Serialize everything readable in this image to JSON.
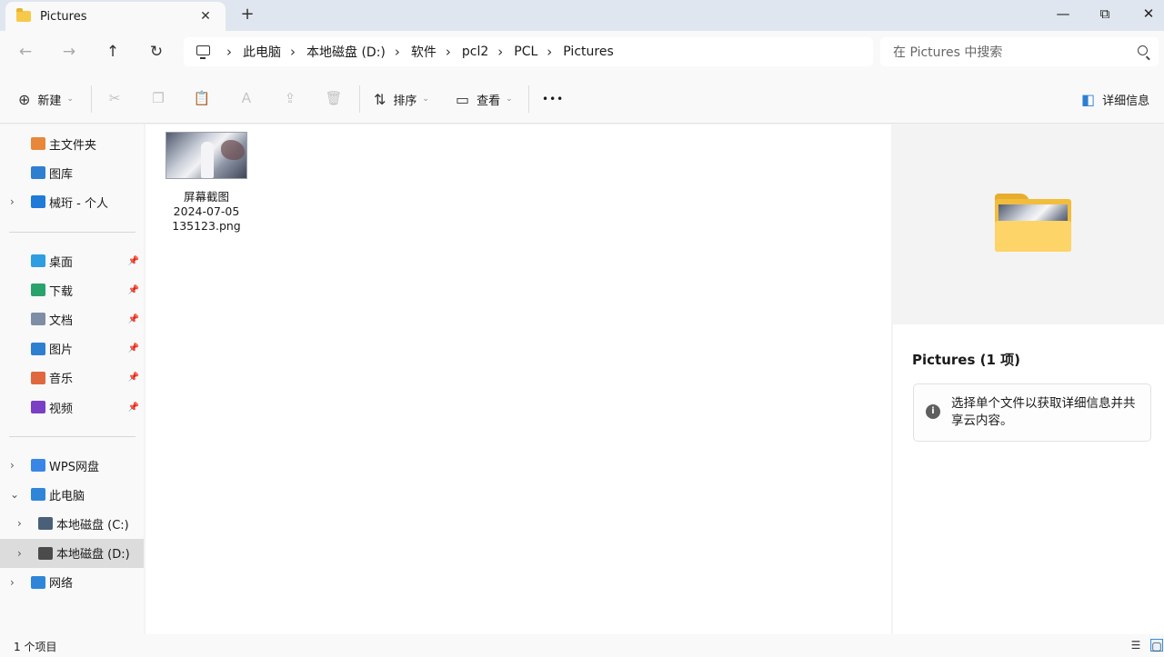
{
  "window": {
    "tab_title": "Pictures",
    "tab_close": "✕",
    "new_tab": "+",
    "minimize": "—",
    "restore": "⧉",
    "close": "✕"
  },
  "nav": {
    "back": "←",
    "forward": "→",
    "up": "↑",
    "refresh": "↻",
    "separator": "›",
    "breadcrumbs": [
      "此电脑",
      "本地磁盘 (D:)",
      "软件",
      "pcl2",
      "PCL",
      "Pictures"
    ],
    "search_placeholder": "在 Pictures 中搜索"
  },
  "toolbar": {
    "new_label": "新建",
    "new_icon": "⊕",
    "cut": "✂",
    "copy": "❐",
    "paste": "📋",
    "rename": "Ａ",
    "share": "⇪",
    "delete": "🗑",
    "sort_label": "排序",
    "sort_icon": "⇅",
    "view_label": "查看",
    "view_icon": "▭",
    "more": "•••",
    "details_label": "详细信息",
    "details_icon": "◧",
    "caret": "⌄"
  },
  "sidebar": {
    "quick": [
      {
        "label": "主文件夹",
        "icon": "home-icon",
        "color": "#e8873a",
        "expand": ""
      },
      {
        "label": "图库",
        "icon": "gallery-icon",
        "color": "#2f7fd1",
        "expand": ""
      },
      {
        "label": "械珩 - 个人",
        "icon": "onedrive-icon",
        "color": "#1f7ad8",
        "expand": "›"
      }
    ],
    "pinned": [
      {
        "label": "桌面",
        "icon": "desktop-icon",
        "color": "#2f9ee0"
      },
      {
        "label": "下载",
        "icon": "download-icon",
        "color": "#2aa26c"
      },
      {
        "label": "文档",
        "icon": "documents-icon",
        "color": "#7e8ea4"
      },
      {
        "label": "图片",
        "icon": "pictures-icon",
        "color": "#2f7fd1"
      },
      {
        "label": "音乐",
        "icon": "music-icon",
        "color": "#e0683f"
      },
      {
        "label": "视频",
        "icon": "videos-icon",
        "color": "#7a3fc4"
      }
    ],
    "pin_glyph": "📌",
    "tree": [
      {
        "label": "WPS网盘",
        "icon": "wps-cloud-icon",
        "color": "#3a86e6",
        "expand": "›",
        "indent": 0
      },
      {
        "label": "此电脑",
        "icon": "this-pc-icon",
        "color": "#2f86d8",
        "expand": "⌄",
        "indent": 0
      },
      {
        "label": "本地磁盘 (C:)",
        "icon": "drive-c-icon",
        "color": "#4a6078",
        "expand": "›",
        "indent": 1
      },
      {
        "label": "本地磁盘 (D:)",
        "icon": "drive-d-icon",
        "color": "#4b4b4b",
        "expand": "›",
        "indent": 1,
        "selected": true
      },
      {
        "label": "网络",
        "icon": "network-icon",
        "color": "#2f86d8",
        "expand": "›",
        "indent": 0
      }
    ]
  },
  "files": [
    {
      "name_lines": [
        "屏幕截图",
        "2024-07-05",
        "135123.png"
      ],
      "type": "image"
    }
  ],
  "details": {
    "title": "Pictures (1 项)",
    "info_icon": "i",
    "info_text": "选择单个文件以获取详细信息并共享云内容。"
  },
  "status": {
    "item_count": "1 个项目",
    "details_view": "☰",
    "large_icons": "▢"
  }
}
